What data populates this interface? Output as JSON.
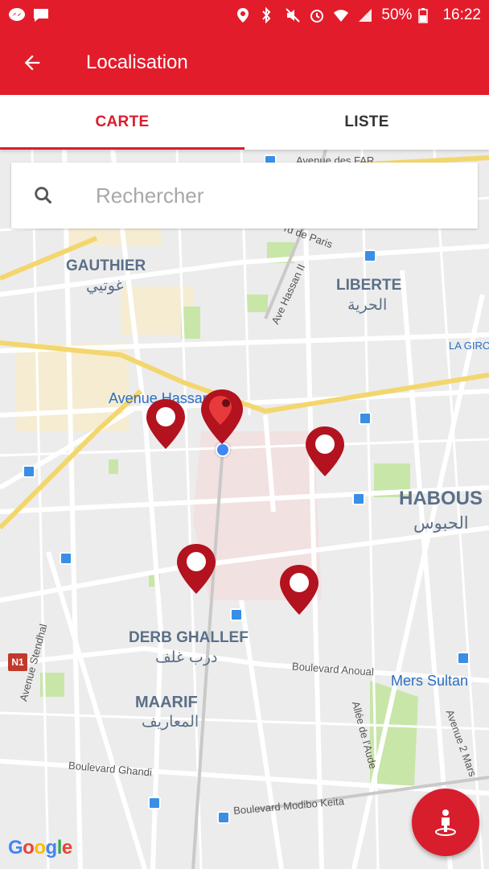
{
  "status_bar": {
    "battery": "50%",
    "time": "16:22"
  },
  "app_bar": {
    "title": "Localisation"
  },
  "tabs": [
    {
      "label": "CARTE",
      "active": true
    },
    {
      "label": "LISTE",
      "active": false
    }
  ],
  "search": {
    "placeholder": "Rechercher",
    "value": ""
  },
  "map": {
    "districts": [
      {
        "name": "GAUTHIER",
        "arabic": "غوتيي"
      },
      {
        "name": "LIBERTE",
        "arabic": "الحرية"
      },
      {
        "name": "HABOUS",
        "arabic": "الحبوس"
      },
      {
        "name": "DERB GHALLEF",
        "arabic": "درب غلف"
      },
      {
        "name": "MAARIF",
        "arabic": "المعاريف"
      }
    ],
    "streets": [
      "Avenue des FAR",
      "rd de Paris",
      "Ave Hassan II",
      "Avenue Hassan",
      "LA GIRO",
      "Avenue Stendhal",
      "Boulevard Anoual",
      "Allée de l'Aude",
      "Avenue 2 Mars",
      "Boulevard Ghandi",
      "Boulevard Modibo Keita"
    ],
    "place_labels": [
      "Mers Sultan"
    ],
    "road_shield": "N1",
    "google_logo": "Google",
    "pin_color": "#b3121f",
    "accent_color": "#e31c2b"
  }
}
